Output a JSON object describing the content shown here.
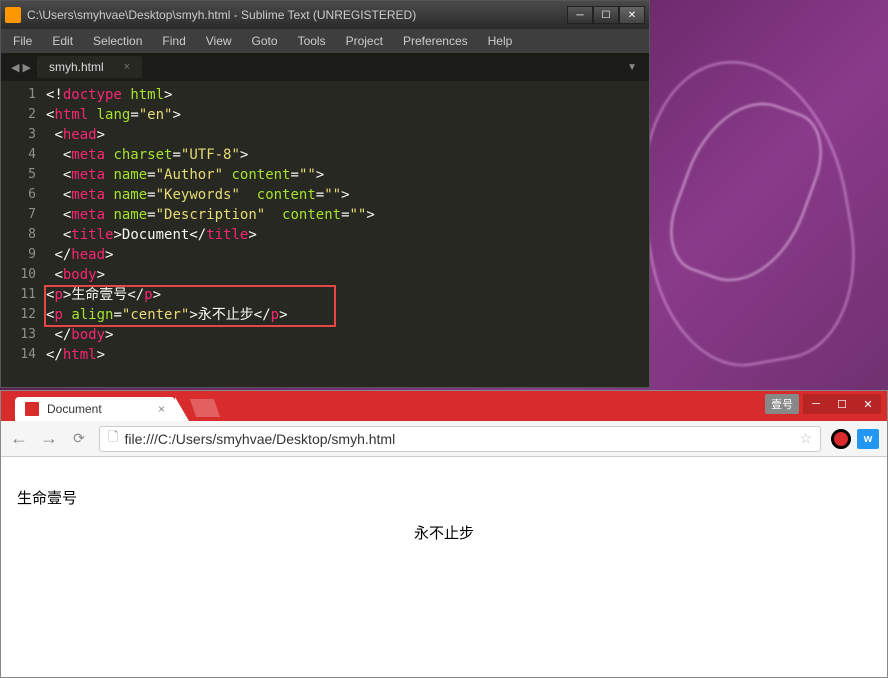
{
  "sublime": {
    "title": "C:\\Users\\smyhvae\\Desktop\\smyh.html - Sublime Text (UNREGISTERED)",
    "menu": {
      "file": "File",
      "edit": "Edit",
      "selection": "Selection",
      "find": "Find",
      "view": "View",
      "goto": "Goto",
      "tools": "Tools",
      "project": "Project",
      "preferences": "Preferences",
      "help": "Help"
    },
    "tab": {
      "name": "smyh.html"
    },
    "lines": [
      "1",
      "2",
      "3",
      "4",
      "5",
      "6",
      "7",
      "8",
      "9",
      "10",
      "11",
      "12",
      "13",
      "14"
    ],
    "code": {
      "l1": {
        "open": "<!",
        "tag": "doctype",
        "sp": " ",
        "attr": "html",
        "close": ">"
      },
      "l2": {
        "open": "<",
        "tag": "html",
        "sp": " ",
        "attr": "lang",
        "eq": "=",
        "val": "\"en\"",
        "close": ">"
      },
      "l3": {
        "open": "<",
        "tag": "head",
        "close": ">"
      },
      "l4": {
        "open": "<",
        "tag": "meta",
        "sp": " ",
        "attr": "charset",
        "eq": "=",
        "val": "\"UTF-8\"",
        "close": ">"
      },
      "l5": {
        "open": "<",
        "tag": "meta",
        "sp": " ",
        "a1": "name",
        "eq1": "=",
        "v1": "\"Author\"",
        "sp2": " ",
        "a2": "content",
        "eq2": "=",
        "v2": "\"\"",
        "close": ">"
      },
      "l6": {
        "open": "<",
        "tag": "meta",
        "sp": " ",
        "a1": "name",
        "eq1": "=",
        "v1": "\"Keywords\"",
        "sp2": "  ",
        "a2": "content",
        "eq2": "=",
        "v2": "\"\"",
        "close": ">"
      },
      "l7": {
        "open": "<",
        "tag": "meta",
        "sp": " ",
        "a1": "name",
        "eq1": "=",
        "v1": "\"Description\"",
        "sp2": "  ",
        "a2": "content",
        "eq2": "=",
        "v2": "\"\"",
        "close": ">"
      },
      "l8": {
        "o1": "<",
        "t1": "title",
        "c1": ">",
        "txt": "Document",
        "o2": "</",
        "t2": "title",
        "c2": ">"
      },
      "l9": {
        "open": "</",
        "tag": "head",
        "close": ">"
      },
      "l10": {
        "open": "<",
        "tag": "body",
        "close": ">"
      },
      "l11": {
        "o1": "<",
        "t1": "p",
        "c1": ">",
        "txt": "生命壹号",
        "o2": "</",
        "t2": "p",
        "c2": ">"
      },
      "l12": {
        "o1": "<",
        "t1": "p",
        "sp": " ",
        "attr": "align",
        "eq": "=",
        "val": "\"center\"",
        "c1": ">",
        "txt": "永不止步",
        "o2": "</",
        "t2": "p",
        "c2": ">"
      },
      "l13": {
        "open": "</",
        "tag": "body",
        "close": ">"
      },
      "l14": {
        "open": "</",
        "tag": "html",
        "close": ">"
      }
    }
  },
  "browser": {
    "tab_title": "Document",
    "chrome_label": "壹号",
    "url": "file:///C:/Users/smyhvae/Desktop/smyh.html",
    "ext_label": "w",
    "content": {
      "p1": "生命壹号",
      "p2": "永不止步"
    }
  }
}
